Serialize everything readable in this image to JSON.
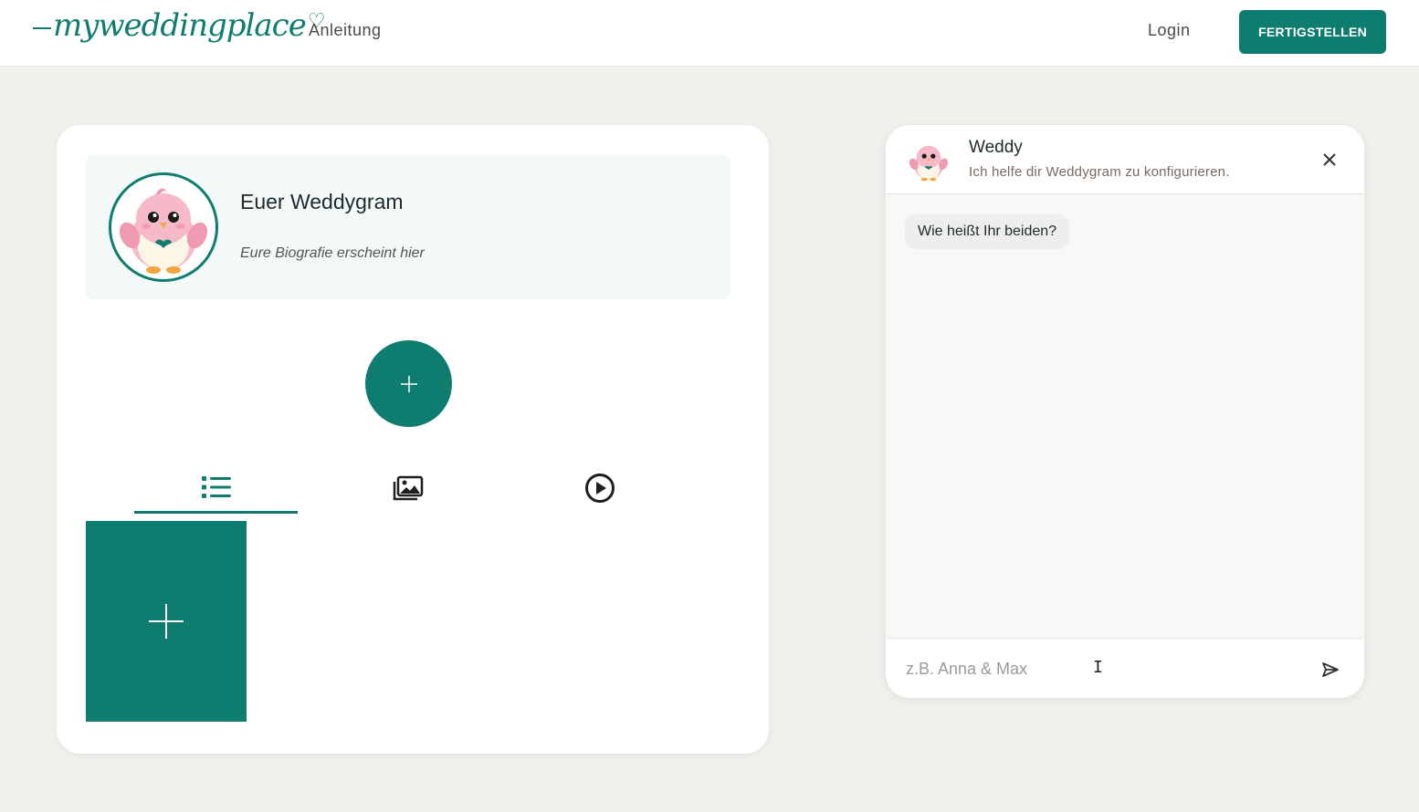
{
  "header": {
    "logo_text": "myweddingplace",
    "nav_link": "Anleitung",
    "login_label": "Login",
    "finish_label": "FERTIGSTELLEN"
  },
  "profile": {
    "title": "Euer Weddygram",
    "bio_placeholder": "Eure Biografie erscheint hier",
    "avatar_icon": "bird-mascot-icon"
  },
  "tabs": [
    {
      "name": "list-icon",
      "active": true
    },
    {
      "name": "photo-gallery-icon",
      "active": false
    },
    {
      "name": "video-play-icon",
      "active": false
    }
  ],
  "chat": {
    "bot_name": "Weddy",
    "bot_subtitle": "Ich helfe dir Weddygram zu konfigurieren.",
    "messages": [
      {
        "from": "bot",
        "text": "Wie heißt Ihr beiden?"
      }
    ],
    "input_placeholder": "z.B. Anna & Max",
    "input_value": ""
  },
  "colors": {
    "accent": "#0f7c70",
    "background": "#f1f0ed"
  }
}
